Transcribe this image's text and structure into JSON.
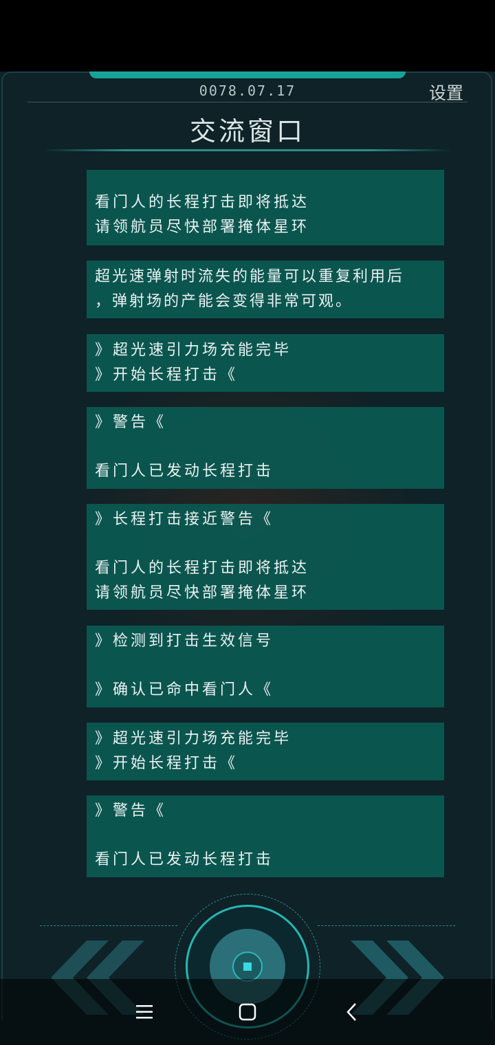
{
  "header": {
    "date": "0078.07.17",
    "settings_label": "设置",
    "title": "交流窗口"
  },
  "messages": [
    {
      "lines": [
        "看门人的长程打击即将抵达",
        "请领航员尽快部署掩体星环"
      ]
    },
    {
      "lines": [
        "超光速弹射时流失的能量可以重复利用后",
        "，弹射场的产能会变得非常可观。"
      ]
    },
    {
      "lines": [
        "》超光速引力场充能完毕",
        "》开始长程打击《"
      ]
    },
    {
      "lines": [
        "》警告《",
        "",
        "看门人已发动长程打击"
      ]
    },
    {
      "lines": [
        "》长程打击接近警告《",
        "",
        "看门人的长程打击即将抵达",
        "请领航员尽快部署掩体星环"
      ]
    },
    {
      "lines": [
        "》检测到打击生效信号",
        "",
        "》确认已命中看门人《"
      ]
    },
    {
      "lines": [
        "》超光速引力场充能完毕",
        "》开始长程打击《"
      ]
    },
    {
      "lines": [
        "》警告《",
        "",
        "看门人已发动长程打击"
      ]
    }
  ],
  "controls": {
    "left_icon": "double-chevron-left-icon",
    "center_icon": "action-knob-icon",
    "right_icon": "double-chevron-right-icon"
  },
  "navbar": {
    "menu_icon": "menu-icon",
    "home_icon": "home-square-icon",
    "back_icon": "back-chevron-icon"
  },
  "colors": {
    "card_bg": "#0b5a52",
    "accent": "#27b7b4",
    "background": "#0e2228"
  }
}
